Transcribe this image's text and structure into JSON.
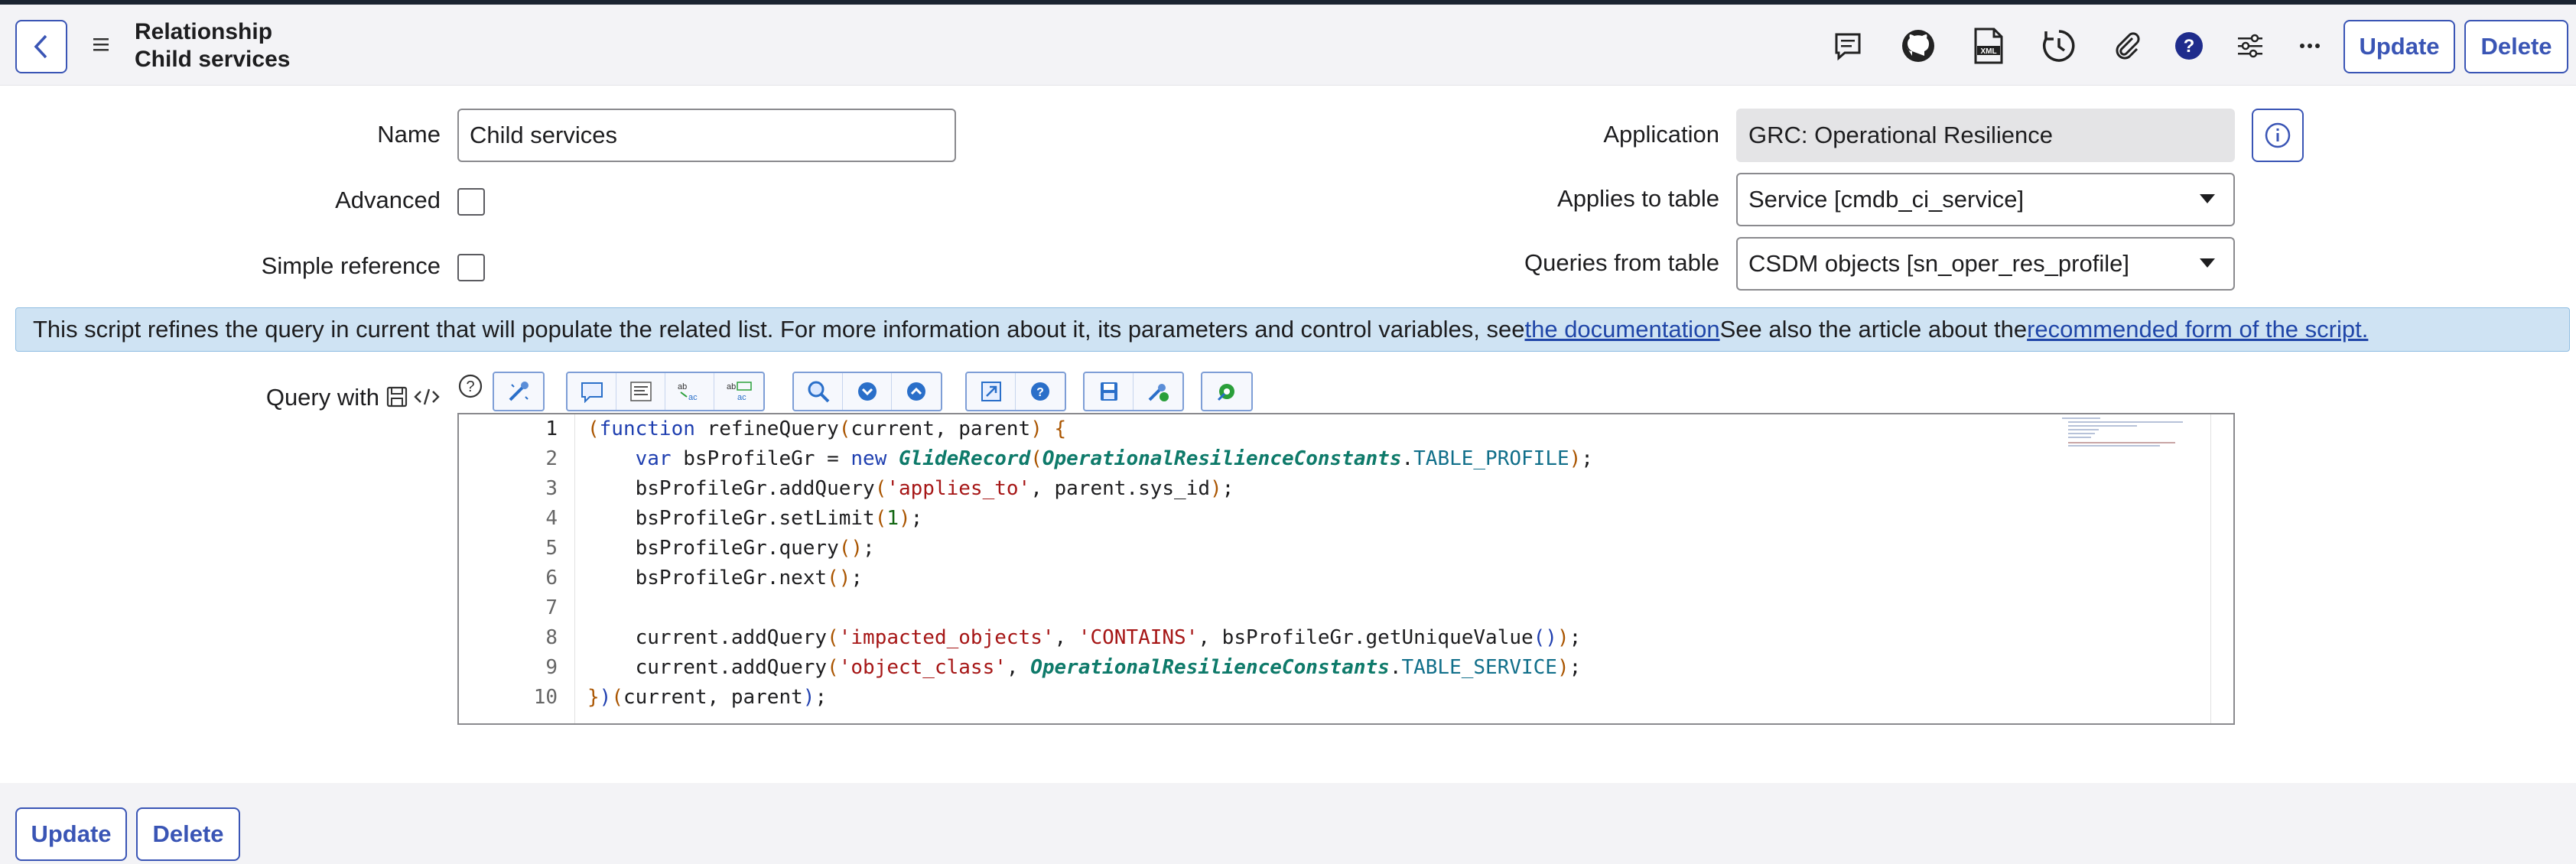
{
  "header": {
    "title_line1": "Relationship",
    "title_line2": "Child services",
    "update_label": "Update",
    "delete_label": "Delete"
  },
  "form": {
    "name_label": "Name",
    "name_value": "Child services",
    "advanced_label": "Advanced",
    "simple_reference_label": "Simple reference",
    "application_label": "Application",
    "application_value": "GRC: Operational Resilience",
    "applies_to_label": "Applies to table",
    "applies_to_value": "Service [cmdb_ci_service]",
    "queries_from_label": "Queries from table",
    "queries_from_value": "CSDM objects [sn_oper_res_profile]"
  },
  "banner": {
    "text_before": "This script refines the query in current that will populate the related list. For more information about it, its parameters and control variables, see ",
    "link1": "the documentation",
    "text_middle": " See also the article about the ",
    "link2": "recommended form of the script."
  },
  "script": {
    "label": "Query with",
    "line_numbers": [
      "1",
      "2",
      "3",
      "4",
      "5",
      "6",
      "7",
      "8",
      "9",
      "10"
    ]
  },
  "footer": {
    "update_label": "Update",
    "delete_label": "Delete"
  },
  "colors": {
    "accent": "#3a55b5",
    "banner_bg": "#cfe3f3",
    "topbar": "#1b2431"
  }
}
